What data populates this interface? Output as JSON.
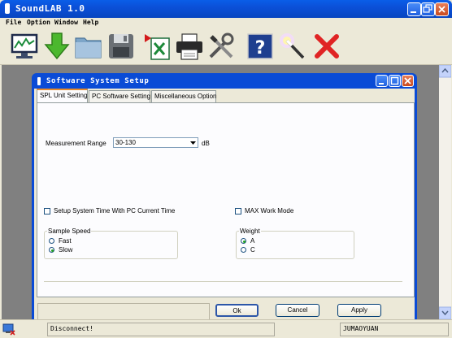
{
  "app": {
    "title": "SoundLAB 1.0"
  },
  "menu": [
    "File",
    "Option",
    "Window",
    "Help"
  ],
  "toolbar": {
    "icons": [
      "monitor-icon",
      "download-arrow-icon",
      "folder-icon",
      "save-icon",
      "excel-export-icon",
      "printer-icon",
      "tools-icon",
      "help-icon",
      "magic-wand-icon",
      "exit-icon"
    ]
  },
  "dialog": {
    "title": "Software System Setup",
    "tabs": [
      "SPL Unit Setting",
      "PC Software Setting",
      "Miscellaneous Option"
    ],
    "measurement_range": {
      "label": "Measurement Range",
      "value": "30-130",
      "unit": "dB"
    },
    "setup_time": {
      "label": "Setup System Time With PC Current Time",
      "checked": false
    },
    "max_mode": {
      "label": "MAX Work Mode",
      "checked": false
    },
    "sample_speed": {
      "caption": "Sample Speed",
      "options": [
        "Fast",
        "Slow"
      ],
      "selected": "Slow"
    },
    "weight": {
      "caption": "Weight",
      "options": [
        "A",
        "C"
      ],
      "selected": "A"
    },
    "buttons": {
      "ok": "Ok",
      "cancel": "Cancel",
      "apply": "Apply"
    }
  },
  "status": {
    "connection": "Disconnect!",
    "user": "JUMAOYUAN"
  }
}
